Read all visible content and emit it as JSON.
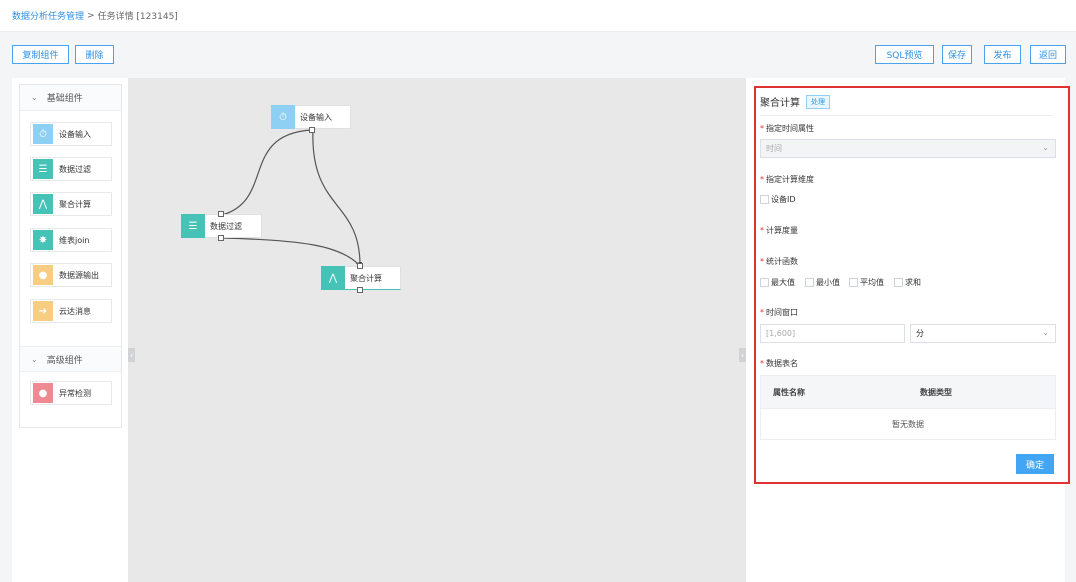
{
  "breadcrumb": {
    "parent": "数据分析任务管理",
    "separator": ">",
    "current": "任务详情 [123145]"
  },
  "toolbar_left": {
    "copy": "复制组件",
    "delete": "删除"
  },
  "toolbar_right": {
    "sql_preview": "SQL预览",
    "save": "保存",
    "publish": "发布",
    "back": "返回"
  },
  "palette": {
    "basic_group": "基础组件",
    "basic_items": [
      {
        "label": "设备输入",
        "icon": "stopwatch-icon",
        "color": "#8dd0f4"
      },
      {
        "label": "数据过滤",
        "icon": "table-icon",
        "color": "#46c2b6"
      },
      {
        "label": "聚合计算",
        "icon": "network-icon",
        "color": "#46c2b6"
      },
      {
        "label": "维表join",
        "icon": "join-icon",
        "color": "#46c2b6"
      },
      {
        "label": "数据源输出",
        "icon": "bulb-icon",
        "color": "#f7cd83"
      },
      {
        "label": "云达消息",
        "icon": "arrow-icon",
        "color": "#f7cd83"
      }
    ],
    "advanced_group": "高级组件",
    "advanced_items": [
      {
        "label": "异常检测",
        "icon": "alert-icon",
        "color": "#ef8a93"
      }
    ]
  },
  "canvas": {
    "nodes": [
      {
        "label": "设备输入",
        "icon": "stopwatch-icon",
        "color": "#8dd0f4"
      },
      {
        "label": "数据过滤",
        "icon": "table-icon",
        "color": "#46c2b6"
      },
      {
        "label": "聚合计算",
        "icon": "network-icon",
        "color": "#46c2b6"
      }
    ]
  },
  "config_panel": {
    "title": "聚合计算",
    "badge": "处理",
    "time_attr_label": "指定时间属性",
    "time_attr_placeholder": "时间",
    "dimension_label": "指定计算维度",
    "dimension_option": "设备ID",
    "measure_label": "计算度量",
    "func_label": "统计函数",
    "func_options": [
      "最大值",
      "最小值",
      "平均值",
      "求和"
    ],
    "window_label": "时间窗口",
    "window_placeholder": "[1,600]",
    "window_unit": "分",
    "table_label": "数据表名",
    "table_headers": [
      "属性名称",
      "数据类型"
    ],
    "table_empty": "暂无数据",
    "confirm": "确定"
  }
}
